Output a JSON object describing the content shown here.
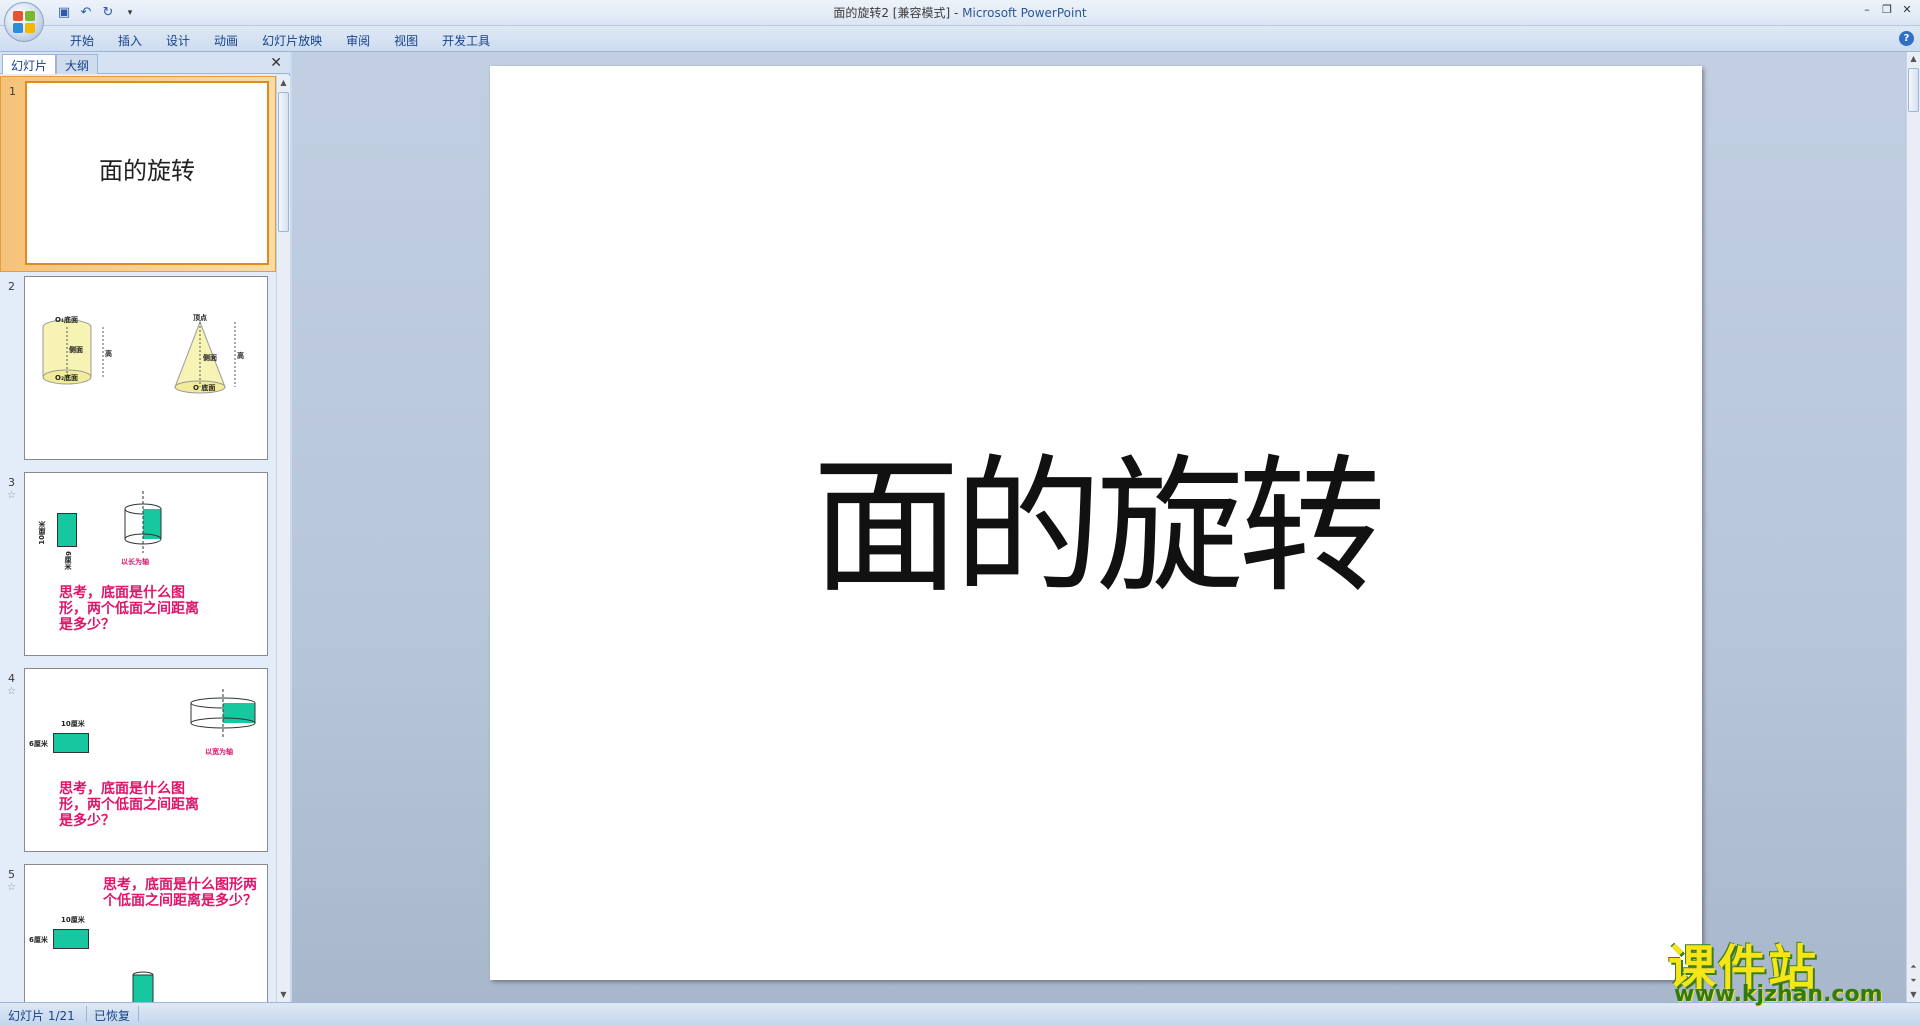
{
  "window": {
    "title_doc": "面的旋转2 [兼容模式] - ",
    "title_app": "Microsoft PowerPoint",
    "controls": [
      "–",
      "❐",
      "✕"
    ]
  },
  "ribbon": {
    "tabs": [
      "开始",
      "插入",
      "设计",
      "动画",
      "幻灯片放映",
      "审阅",
      "视图",
      "开发工具"
    ]
  },
  "left_pane": {
    "tabs": [
      "幻灯片",
      "大纲"
    ],
    "close": "✕",
    "slides": [
      {
        "num": "1",
        "title": "面的旋转"
      },
      {
        "num": "2",
        "labels": [
          "O₁底面",
          "高",
          "侧面",
          "O₂底面",
          "顶点",
          "高",
          "侧面",
          "O 底面"
        ]
      },
      {
        "num": "3",
        "labels": [
          "10厘米",
          "6厘米",
          "以长为轴"
        ],
        "question": "思考，底面是什么图形，两个低面之间距离是多少？"
      },
      {
        "num": "4",
        "labels": [
          "10厘米",
          "6厘米",
          "以宽为轴"
        ],
        "question": "思考，底面是什么图形，两个低面之间距离是多少？"
      },
      {
        "num": "5",
        "labels": [
          "10厘米",
          "6厘米"
        ],
        "question": "思考，底面是什么图形两个低面之间距离是多少？"
      }
    ]
  },
  "slide": {
    "title": "面的旋转"
  },
  "statusbar": {
    "slide_count": "幻灯片 1/21",
    "state": "已恢复"
  },
  "watermark": {
    "main": "课件站",
    "sub": "www.kjzhan.com"
  },
  "colors": {
    "accent_pink": "#e0156a",
    "teal": "#17c7a0",
    "selection": "#f5c27a"
  }
}
